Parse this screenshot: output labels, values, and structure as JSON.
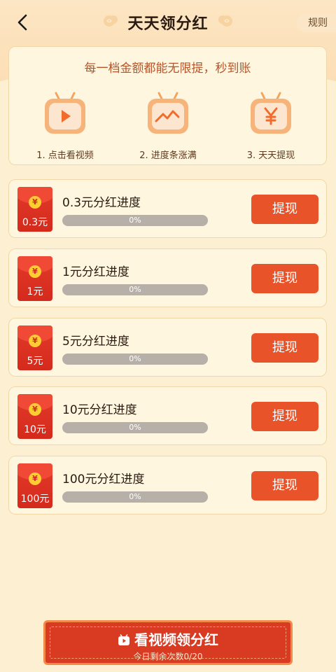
{
  "header": {
    "title": "天天领分红",
    "rules_label": "规则"
  },
  "steps": {
    "headline": "每一档金额都能无限提，秒到账",
    "items": [
      {
        "label": "1. 点击看视频",
        "icon": "play-tv-icon"
      },
      {
        "label": "2. 进度条涨满",
        "icon": "trend-tv-icon"
      },
      {
        "label": "3. 天天提现",
        "icon": "yen-tv-icon"
      }
    ]
  },
  "tiers": [
    {
      "envelope_amount": "0.3元",
      "title": "0.3元分红进度",
      "progress_text": "0%",
      "progress": 0,
      "button": "提现"
    },
    {
      "envelope_amount": "1元",
      "title": "1元分红进度",
      "progress_text": "0%",
      "progress": 0,
      "button": "提现"
    },
    {
      "envelope_amount": "5元",
      "title": "5元分红进度",
      "progress_text": "0%",
      "progress": 0,
      "button": "提现"
    },
    {
      "envelope_amount": "10元",
      "title": "10元分红进度",
      "progress_text": "0%",
      "progress": 0,
      "button": "提现"
    },
    {
      "envelope_amount": "100元",
      "title": "100元分红进度",
      "progress_text": "0%",
      "progress": 0,
      "button": "提现"
    }
  ],
  "envelope_coin_symbol": "¥",
  "cta": {
    "label": "看视频领分红",
    "sub_label": "今日剩余次数0/20"
  },
  "colors": {
    "accent": "#e8532a",
    "background": "#fdf0d2",
    "envelope_red": "#d42a1c"
  }
}
